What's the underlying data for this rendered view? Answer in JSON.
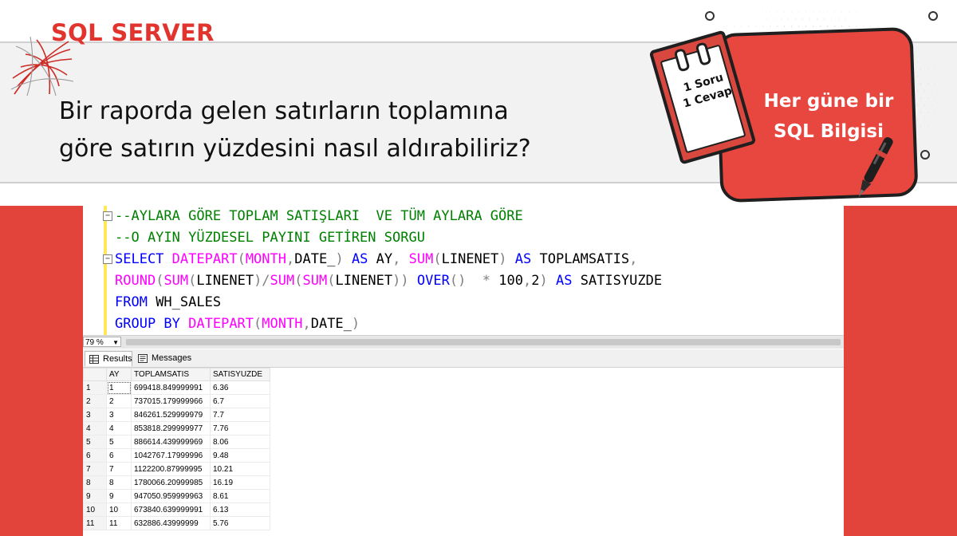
{
  "header": {
    "brand": "SQL SERVER",
    "question_lines": [
      "Bir raporda gelen satırların toplamına",
      "göre satırın yüzdesini nasıl aldırabiliriz?"
    ],
    "badge_lines": [
      "Her güne bir",
      "SQL Bilgisi"
    ],
    "notepad_lines": [
      "1 Soru",
      "1 Cevap"
    ]
  },
  "colors": {
    "brand_red": "#e2342f",
    "badge_red": "#e7473f",
    "sql_keyword": "#0000ff",
    "sql_function": "#ff00ff",
    "sql_comment": "#008000"
  },
  "editor": {
    "lines": [
      [
        {
          "t": "--AYLARA GÖRE TOPLAM SATIŞLARI  VE TÜM AYLARA GÖRE",
          "c": "cm"
        }
      ],
      [
        {
          "t": "--O AYIN YÜZDESEL PAYINI GETİREN SORGU",
          "c": "cm"
        }
      ],
      [
        {
          "t": "SELECT",
          "c": "kw"
        },
        {
          "t": " ",
          "c": "tx"
        },
        {
          "t": "DATEPART",
          "c": "fn"
        },
        {
          "t": "(",
          "c": "gy"
        },
        {
          "t": "MONTH",
          "c": "fn"
        },
        {
          "t": ",",
          "c": "gy"
        },
        {
          "t": "DATE_",
          "c": "tx"
        },
        {
          "t": ")",
          "c": "gy"
        },
        {
          "t": " ",
          "c": "tx"
        },
        {
          "t": "AS",
          "c": "kw"
        },
        {
          "t": " AY",
          "c": "tx"
        },
        {
          "t": ",",
          "c": "gy"
        },
        {
          "t": " ",
          "c": "tx"
        },
        {
          "t": "SUM",
          "c": "fn"
        },
        {
          "t": "(",
          "c": "gy"
        },
        {
          "t": "LINENET",
          "c": "tx"
        },
        {
          "t": ")",
          "c": "gy"
        },
        {
          "t": " ",
          "c": "tx"
        },
        {
          "t": "AS",
          "c": "kw"
        },
        {
          "t": " TOPLAMSATIS",
          "c": "tx"
        },
        {
          "t": ",",
          "c": "gy"
        }
      ],
      [
        {
          "t": "ROUND",
          "c": "fn"
        },
        {
          "t": "(",
          "c": "gy"
        },
        {
          "t": "SUM",
          "c": "fn"
        },
        {
          "t": "(",
          "c": "gy"
        },
        {
          "t": "LINENET",
          "c": "tx"
        },
        {
          "t": ")/",
          "c": "gy"
        },
        {
          "t": "SUM",
          "c": "fn"
        },
        {
          "t": "(",
          "c": "gy"
        },
        {
          "t": "SUM",
          "c": "fn"
        },
        {
          "t": "(",
          "c": "gy"
        },
        {
          "t": "LINENET",
          "c": "tx"
        },
        {
          "t": "))",
          "c": "gy"
        },
        {
          "t": " ",
          "c": "tx"
        },
        {
          "t": "OVER",
          "c": "kw"
        },
        {
          "t": "()",
          "c": "gy"
        },
        {
          "t": "  ",
          "c": "tx"
        },
        {
          "t": "*",
          "c": "gy"
        },
        {
          "t": " 100",
          "c": "tx"
        },
        {
          "t": ",",
          "c": "gy"
        },
        {
          "t": "2",
          "c": "tx"
        },
        {
          "t": ")",
          "c": "gy"
        },
        {
          "t": " ",
          "c": "tx"
        },
        {
          "t": "AS",
          "c": "kw"
        },
        {
          "t": " SATISYUZDE",
          "c": "tx"
        }
      ],
      [
        {
          "t": "FROM",
          "c": "kw"
        },
        {
          "t": " WH_SALES",
          "c": "tx"
        }
      ],
      [
        {
          "t": "GROUP BY",
          "c": "kw"
        },
        {
          "t": " ",
          "c": "tx"
        },
        {
          "t": "DATEPART",
          "c": "fn"
        },
        {
          "t": "(",
          "c": "gy"
        },
        {
          "t": "MONTH",
          "c": "fn"
        },
        {
          "t": ",",
          "c": "gy"
        },
        {
          "t": "DATE_",
          "c": "tx"
        },
        {
          "t": ")",
          "c": "gy"
        }
      ]
    ]
  },
  "status": {
    "zoom": "79 %"
  },
  "tabs": [
    {
      "label": "Results",
      "icon": "grid-icon"
    },
    {
      "label": "Messages",
      "icon": "messages-icon"
    }
  ],
  "results": {
    "columns": [
      "AY",
      "TOPLAMSATIS",
      "SATISYUZDE"
    ],
    "rows": [
      [
        "1",
        "1",
        "699418.849999991",
        "6.36"
      ],
      [
        "2",
        "2",
        "737015.179999966",
        "6.7"
      ],
      [
        "3",
        "3",
        "846261.529999979",
        "7.7"
      ],
      [
        "4",
        "4",
        "853818.299999977",
        "7.76"
      ],
      [
        "5",
        "5",
        "886614.439999969",
        "8.06"
      ],
      [
        "6",
        "6",
        "1042767.17999996",
        "9.48"
      ],
      [
        "7",
        "7",
        "1122200.87999995",
        "10.21"
      ],
      [
        "8",
        "8",
        "1780066.20999985",
        "16.19"
      ],
      [
        "9",
        "9",
        "947050.959999963",
        "8.61"
      ],
      [
        "10",
        "10",
        "673840.639999991",
        "6.13"
      ],
      [
        "11",
        "11",
        "632886.43999999",
        "5.76"
      ]
    ]
  }
}
